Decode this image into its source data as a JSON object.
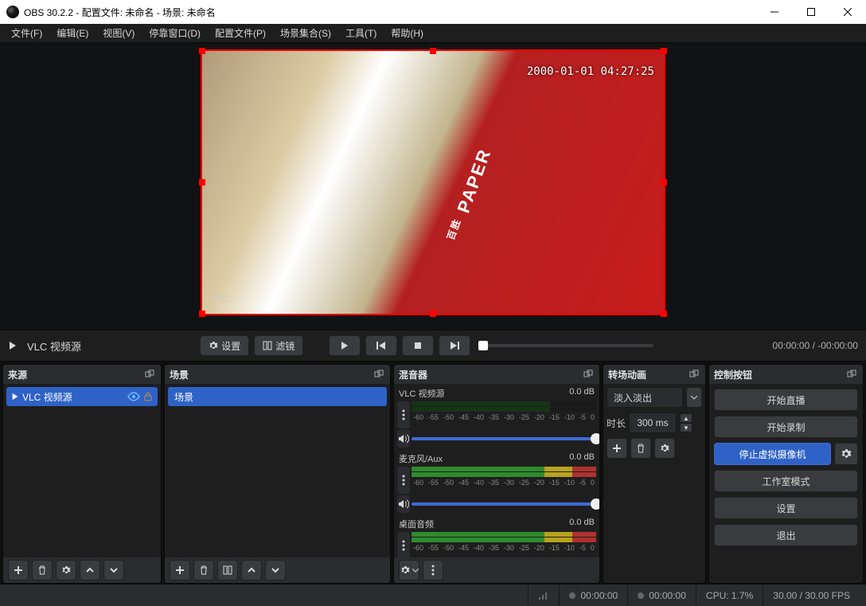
{
  "window": {
    "title": "OBS 30.2.2 - 配置文件: 未命名 - 场景: 未命名"
  },
  "menu": {
    "file": "文件(F)",
    "edit": "编辑(E)",
    "view": "视图(V)",
    "dock": "停靠窗口(D)",
    "profile": "配置文件(P)",
    "scenecol": "场景集合(S)",
    "tools": "工具(T)",
    "help": "帮助(H)"
  },
  "preview": {
    "timestamp": "2000-01-01 04:27:25",
    "ipc": "IPC",
    "paper": "PAPER",
    "brand": "百胜"
  },
  "srcbar": {
    "source_name": "VLC 视频源",
    "settings": "设置",
    "filters": "滤镜",
    "time_cur": "00:00:00",
    "time_dur": "-00:00:00"
  },
  "dock_sources": {
    "title": "来源",
    "item": "VLC 视频源"
  },
  "dock_scenes": {
    "title": "场景",
    "item": "场景"
  },
  "dock_mixer": {
    "title": "混音器",
    "db": "0.0 dB",
    "ch1": "VLC 视频源",
    "ch2": "麦克风/Aux",
    "ch3": "桌面音频",
    "scale": [
      "-60",
      "-55",
      "-50",
      "-45",
      "-40",
      "-35",
      "-30",
      "-25",
      "-20",
      "-15",
      "-10",
      "-5",
      "0"
    ]
  },
  "dock_trans": {
    "title": "转场动画",
    "mode": "淡入淡出",
    "dur_label": "时长",
    "dur_value": "300 ms"
  },
  "dock_ctrl": {
    "title": "控制按钮",
    "start_stream": "开始直播",
    "start_record": "开始录制",
    "stop_vcam": "停止虚拟摄像机",
    "studio": "工作室模式",
    "settings": "设置",
    "exit": "退出"
  },
  "status": {
    "live_time": "00:00:00",
    "rec_time": "00:00:00",
    "cpu": "CPU: 1.7%",
    "fps": "30.00 / 30.00 FPS"
  }
}
